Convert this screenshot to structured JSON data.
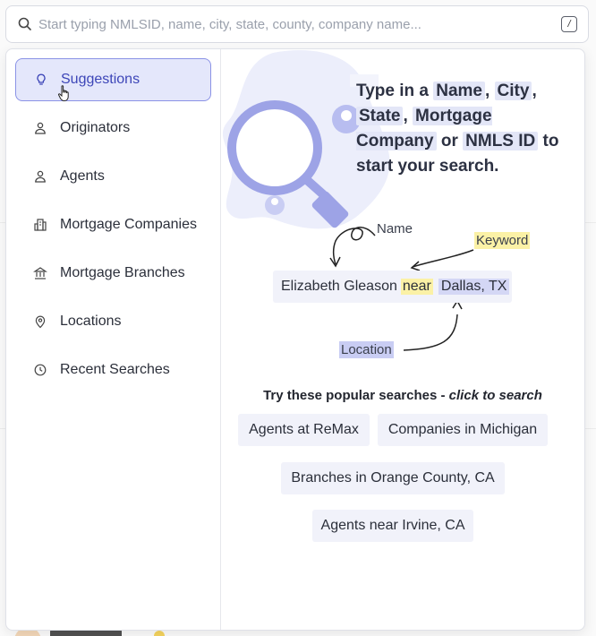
{
  "search": {
    "placeholder": "Start typing NMLSID, name, city, state, county, company name...",
    "shortcut_key": "/"
  },
  "sidebar": {
    "items": [
      {
        "label": "Suggestions",
        "icon": "lightbulb-icon",
        "active": true
      },
      {
        "label": "Originators",
        "icon": "person-icon"
      },
      {
        "label": "Agents",
        "icon": "person-icon"
      },
      {
        "label": "Mortgage Companies",
        "icon": "building-icon"
      },
      {
        "label": "Mortgage Branches",
        "icon": "bank-icon"
      },
      {
        "label": "Locations",
        "icon": "map-pin-icon"
      },
      {
        "label": "Recent Searches",
        "icon": "clock-icon"
      }
    ]
  },
  "hero": {
    "intro": "Type in a",
    "name": "Name",
    "city": "City",
    "state": "State",
    "mortgage_company": "Mortgage Company",
    "or": "or",
    "nmls_id": "NMLS ID",
    "outro": "to start your search."
  },
  "example": {
    "label_name": "Name",
    "label_keyword": "Keyword",
    "label_location": "Location",
    "query_name": "Elizabeth Gleason",
    "query_keyword": "near",
    "query_location": "Dallas, TX"
  },
  "popular": {
    "heading": "Try these popular searches -",
    "heading_emph": "click to search",
    "chips": [
      "Agents at ReMax",
      "Companies in Michigan",
      "Branches in Orange County, CA",
      "Agents near Irvine, CA"
    ]
  },
  "colors": {
    "accent": "#8b93e6",
    "active_bg": "#e4e7fb",
    "keyword_highlight": "#fbf1a6",
    "location_highlight": "#c9cdf3"
  }
}
